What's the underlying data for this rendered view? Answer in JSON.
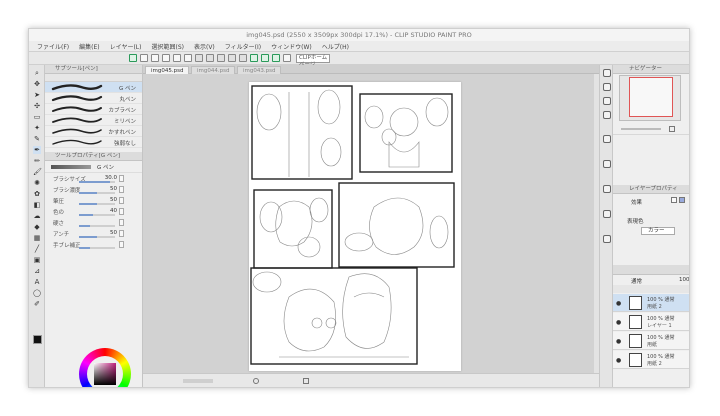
{
  "window": {
    "title": "img045.psd (2550 x 3509px 300dpi 17.1%) - CLIP STUDIO PAINT PRO"
  },
  "menu": [
    "ファイル(F)",
    "編集(E)",
    "レイヤー(L)",
    "選択範囲(S)",
    "表示(V)",
    "フィルター(I)",
    "ウィンドウ(W)",
    "ヘルプ(H)"
  ],
  "toolbar": {
    "zoom_field": "CLIPホームページ"
  },
  "tabs": [
    "img045.psd",
    "img044.psd",
    "img043.psd"
  ],
  "sub_tool": {
    "header": "サブツール[ペン]",
    "brushes": [
      {
        "label": "G ペン",
        "selected": true
      },
      {
        "label": "丸ペン",
        "selected": false
      },
      {
        "label": "カブラペン",
        "selected": false
      },
      {
        "label": "ミリペン",
        "selected": false
      },
      {
        "label": "かすれペン",
        "selected": false
      },
      {
        "label": "強弱なし",
        "selected": false
      }
    ]
  },
  "tool_property": {
    "header": "ツールプロパティ[G ペン]",
    "brush_name": "G ペン",
    "rows": [
      {
        "label": "ブラシサイズ",
        "value": "30.0",
        "level": 0.85
      },
      {
        "label": "ブラシ濃度",
        "value": "50",
        "level": 0.5
      },
      {
        "label": "筆圧",
        "value": "50",
        "level": 0.5
      },
      {
        "label": "色の",
        "value": "40",
        "level": 0.4
      },
      {
        "label": "硬さ",
        "value": "",
        "level": 0.3
      },
      {
        "label": "アンチ",
        "value": "50",
        "level": 0.5
      },
      {
        "label": "手ブレ補正",
        "value": "",
        "level": 0.3
      }
    ]
  },
  "navigator": {
    "header": "ナビゲーター"
  },
  "layer_property": {
    "header": "レイヤープロパティ",
    "effect_label": "効果",
    "expression_label": "表現色",
    "expression_value": "カラー"
  },
  "layers": {
    "blend_mode": "通常",
    "opacity_top": "100",
    "items": [
      {
        "opacity": "100 %",
        "mode": "通常",
        "name": "用紙 2",
        "selected": true
      },
      {
        "opacity": "100 %",
        "mode": "通常",
        "name": "レイヤー 1",
        "selected": false
      },
      {
        "opacity": "100 %",
        "mode": "通常",
        "name": "用紙",
        "selected": false
      },
      {
        "opacity": "100 %",
        "mode": "通常",
        "name": "用紙 2",
        "selected": false
      }
    ]
  },
  "colors": {
    "accent": "#e05555",
    "selection": "#cfe0f2",
    "status_green": "#2a9a5a"
  }
}
